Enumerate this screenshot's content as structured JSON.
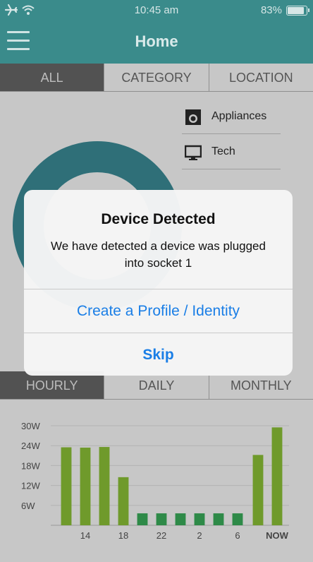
{
  "status_bar": {
    "time": "10:45 am",
    "battery": "83%",
    "battery_level": 0.83
  },
  "nav": {
    "title": "Home"
  },
  "top_tabs": [
    "ALL",
    "CATEGORY",
    "LOCATION"
  ],
  "legend": [
    {
      "label": "Appliances",
      "icon": "appliance-icon"
    },
    {
      "label": "Tech",
      "icon": "monitor-icon"
    }
  ],
  "bottom_tabs": [
    "HOURLY",
    "DAILY",
    "MONTHLY"
  ],
  "alert": {
    "title": "Device Detected",
    "message": "We have detected a device was plugged into socket 1",
    "primary_button": "Create a Profile / Identity",
    "secondary_button": "Skip"
  },
  "chart_data": {
    "type": "bar",
    "title": "",
    "y_ticks": [
      "30W",
      "24W",
      "18W",
      "12W",
      "6W"
    ],
    "ylim": [
      0,
      30
    ],
    "x_tick_labels": [
      "14",
      "18",
      "22",
      "2",
      "6",
      "NOW"
    ],
    "values": [
      23.5,
      23.4,
      23.6,
      14.5,
      3.6,
      3.6,
      3.6,
      3.6,
      3.6,
      3.6,
      21.2,
      29.5
    ],
    "colors": [
      "#6f9a2b",
      "#6f9a2b",
      "#6f9a2b",
      "#6f9a2b",
      "#2e8a48",
      "#2e8a48",
      "#2e8a48",
      "#2e8a48",
      "#2e8a48",
      "#2e8a48",
      "#6f9a2b",
      "#6f9a2b"
    ],
    "grid": true
  }
}
